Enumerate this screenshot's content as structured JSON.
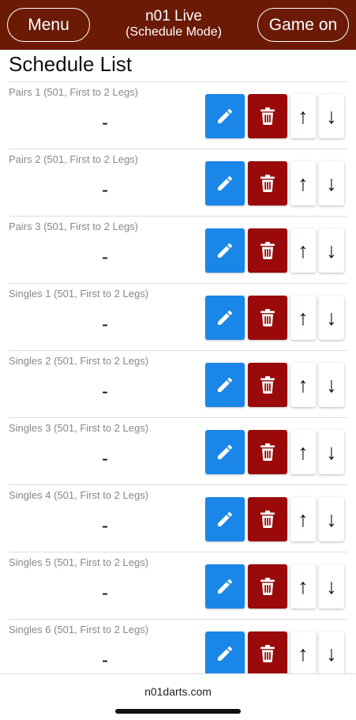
{
  "header": {
    "menu_label": "Menu",
    "title": "n01 Live",
    "subtitle": "(Schedule Mode)",
    "game_on_label": "Game on",
    "background_color": "#6b1a06"
  },
  "page_title": "Schedule List",
  "actions": {
    "edit_icon": "pencil-icon",
    "delete_icon": "trash-icon",
    "up_label": "↑",
    "down_label": "↓",
    "edit_color": "#1a87e8",
    "delete_color": "#9a0a0a"
  },
  "schedule": [
    {
      "label": "Pairs 1 (501, First to 2 Legs)",
      "score": "-"
    },
    {
      "label": "Pairs 2 (501, First to 2 Legs)",
      "score": "-"
    },
    {
      "label": "Pairs 3 (501, First to 2 Legs)",
      "score": "-"
    },
    {
      "label": "Singles 1 (501, First to 2 Legs)",
      "score": "-"
    },
    {
      "label": "Singles 2 (501, First to 2 Legs)",
      "score": "-"
    },
    {
      "label": "Singles 3 (501, First to 2 Legs)",
      "score": "-"
    },
    {
      "label": "Singles 4 (501, First to 2 Legs)",
      "score": "-"
    },
    {
      "label": "Singles 5 (501, First to 2 Legs)",
      "score": "-"
    },
    {
      "label": "Singles 6 (501, First to 2 Legs)",
      "score": "-"
    }
  ],
  "footer": {
    "site": "n01darts.com"
  }
}
